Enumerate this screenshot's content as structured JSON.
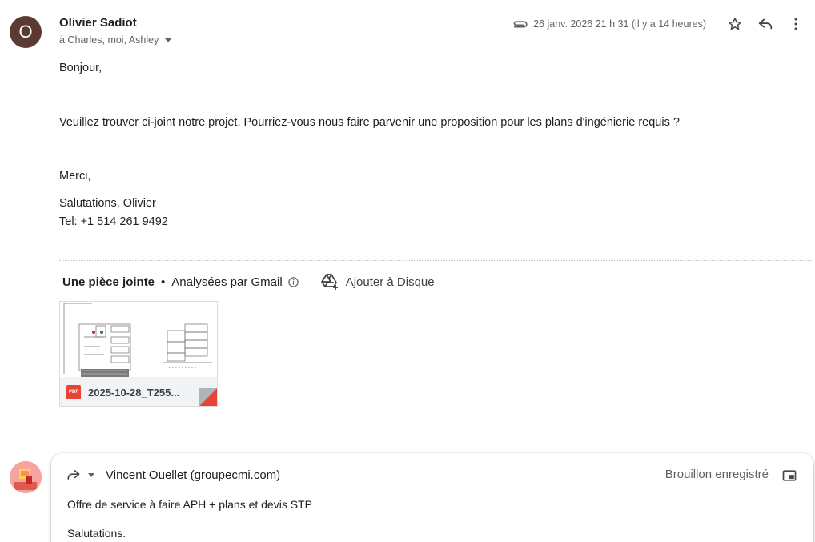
{
  "message": {
    "sender": {
      "name": "Olivier Sadiot",
      "avatar_letter": "O",
      "avatar_color": "#5b3a32"
    },
    "recipients_line": "à Charles, moi, Ashley",
    "date": "26 janv. 2026 21 h 31 (il y a 14 heures)",
    "icons": {
      "attachment": "paperclip-icon",
      "star": "star-icon",
      "reply": "reply-icon",
      "more": "more-vert-icon"
    },
    "body": {
      "greeting": "Bonjour,",
      "paragraph": "Veuillez trouver ci-joint notre projet. Pourriez-vous nous faire parvenir une proposition pour les plans d'ingénierie requis ?",
      "thanks": "Merci,",
      "signature_line1": "Salutations, Olivier",
      "signature_line2": "Tel: +1 514 261 9492"
    }
  },
  "attachments": {
    "count_label": "Une pièce jointe",
    "separator": "•",
    "scanned_label": "Analysées par Gmail",
    "add_to_drive_label": "Ajouter à Disque",
    "files": [
      {
        "name": "2025-10-28_T255...",
        "type_badge": "PDF"
      }
    ]
  },
  "reply": {
    "to": "Vincent Ouellet (groupecmi.com)",
    "status": "Brouillon enregistré",
    "line1": "Offre de service à faire APH + plans et devis STP",
    "line2": "Salutations."
  },
  "colors": {
    "pdf_red": "#ea4335",
    "muted_text": "#5f6368"
  }
}
